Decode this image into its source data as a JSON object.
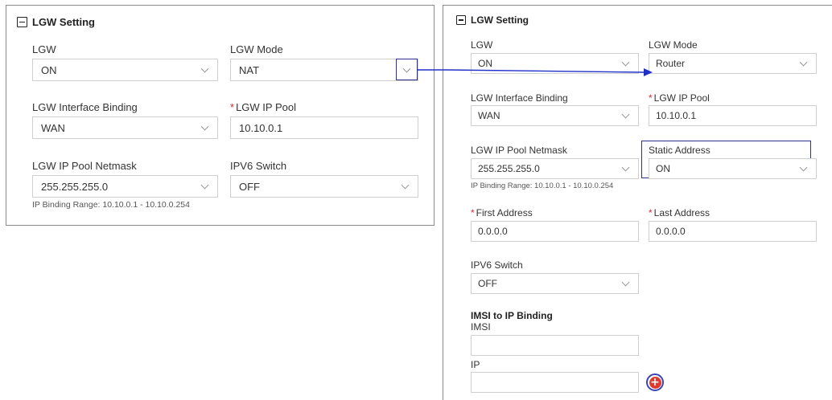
{
  "left_panel": {
    "title": "LGW Setting",
    "lgw": {
      "label": "LGW",
      "value": "ON"
    },
    "lgw_mode": {
      "label": "LGW Mode",
      "value": "NAT"
    },
    "interface_binding": {
      "label": "LGW Interface Binding",
      "value": "WAN"
    },
    "ip_pool": {
      "label": "LGW IP Pool",
      "value": "10.10.0.1"
    },
    "netmask": {
      "label": "LGW IP Pool Netmask",
      "value": "255.255.255.0"
    },
    "ipv6_switch": {
      "label": "IPV6 Switch",
      "value": "OFF"
    },
    "binding_range": "IP Binding Range: 10.10.0.1 - 10.10.0.254"
  },
  "right_panel": {
    "title": "LGW Setting",
    "lgw": {
      "label": "LGW",
      "value": "ON"
    },
    "lgw_mode": {
      "label": "LGW Mode",
      "value": "Router"
    },
    "interface_binding": {
      "label": "LGW Interface Binding",
      "value": "WAN"
    },
    "ip_pool": {
      "label": "LGW IP Pool",
      "value": "10.10.0.1"
    },
    "netmask": {
      "label": "LGW IP Pool Netmask",
      "value": "255.255.255.0"
    },
    "static_address": {
      "label": "Static Address",
      "value": "ON"
    },
    "binding_range": "IP Binding Range: 10.10.0.1 - 10.10.0.254",
    "first_address": {
      "label": "First Address",
      "value": "0.0.0.0"
    },
    "last_address": {
      "label": "Last Address",
      "value": "0.0.0.0"
    },
    "ipv6_switch": {
      "label": "IPV6 Switch",
      "value": "OFF"
    },
    "imsi_binding": {
      "title": "IMSI to IP Binding",
      "imsi_label": "IMSI",
      "imsi_value": "",
      "ip_label": "IP",
      "ip_value": ""
    }
  },
  "required_marker": "*",
  "add_button_symbol": "+",
  "colors": {
    "highlight": "#2b2f8f",
    "arrow": "#1f2fc9",
    "required": "#e0262b",
    "add_button": "#e03a2e"
  },
  "icons": [
    "collapse-icon",
    "chevron-down-icon",
    "add-icon"
  ]
}
